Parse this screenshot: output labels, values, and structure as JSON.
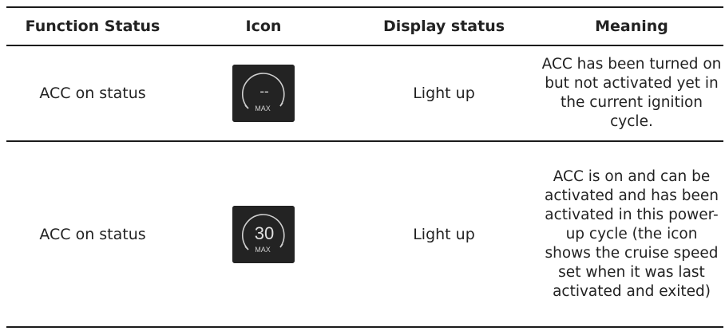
{
  "headers": {
    "function_status": "Function Status",
    "icon": "Icon",
    "display_status": "Display status",
    "meaning": "Meaning"
  },
  "rows": [
    {
      "function_status": "ACC on status",
      "icon": {
        "name": "acc-speed-icon",
        "speed_text": "--",
        "sub_text": "MAX"
      },
      "display_status": "Light up",
      "meaning": "ACC has been turned on but not activated yet in the current ignition cycle."
    },
    {
      "function_status": "ACC on status",
      "icon": {
        "name": "acc-speed-icon",
        "speed_text": "30",
        "sub_text": "MAX"
      },
      "display_status": "Light up",
      "meaning": "ACC is on and can be activated and has been activated in this power-up cycle (the icon shows the cruise speed set when it was last activated and exited)"
    }
  ],
  "colors": {
    "icon_background": "#232323",
    "icon_foreground": "#d9d9d9",
    "rule": "#1a1a1a"
  }
}
